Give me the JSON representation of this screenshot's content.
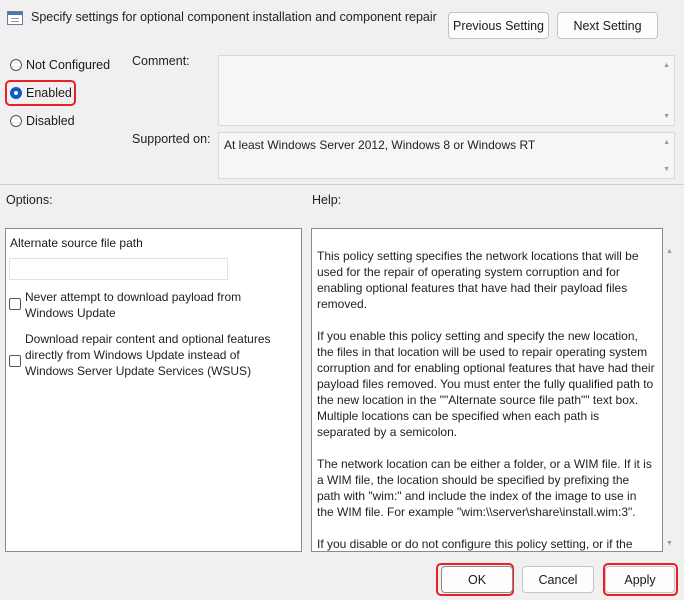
{
  "window": {
    "title": "Specify settings for optional component installation and component repair",
    "icon": "policy-setting-icon"
  },
  "nav": {
    "previous_label": "Previous Setting",
    "next_label": "Next Setting"
  },
  "state": {
    "options": [
      "Not Configured",
      "Enabled",
      "Disabled"
    ],
    "selected": "Enabled"
  },
  "comment": {
    "label": "Comment:",
    "value": ""
  },
  "supported": {
    "label": "Supported on:",
    "value": "At least Windows Server 2012, Windows 8 or Windows RT"
  },
  "options_panel": {
    "heading": "Options:",
    "alternate_label": "Alternate source file path",
    "alternate_value": "",
    "checkbox_1": {
      "label": "Never attempt to download payload from Windows Update",
      "checked": false
    },
    "checkbox_2": {
      "label": "Download repair content and optional features directly from Windows Update instead of Windows Server Update Services (WSUS)",
      "checked": false
    }
  },
  "help_panel": {
    "heading": "Help:",
    "paragraphs": [
      "This policy setting specifies the network locations that will be used for the repair of operating system corruption and for enabling optional features that have had their payload files removed.",
      "If you enable this policy setting and specify the new location, the files in that location will be used to repair operating system corruption and for enabling optional features that have had their payload files removed. You must enter the fully qualified path to the new location in the \"\"Alternate source file path\"\" text box. Multiple locations can be specified when each path is separated by a semicolon.",
      "The network location can be either a folder, or a WIM file. If it is a WIM file, the location should be specified by prefixing the path with \"wim:\" and include the index of the image to use in the WIM file. For example \"wim:\\\\server\\share\\install.wim:3\".",
      "If you disable or do not configure this policy setting, or if the"
    ]
  },
  "footer": {
    "ok_label": "OK",
    "cancel_label": "Cancel",
    "apply_label": "Apply"
  },
  "colors": {
    "highlight": "#e8202a",
    "radio_selected": "#0a59c5",
    "window_bg": "#f0f0f0"
  }
}
